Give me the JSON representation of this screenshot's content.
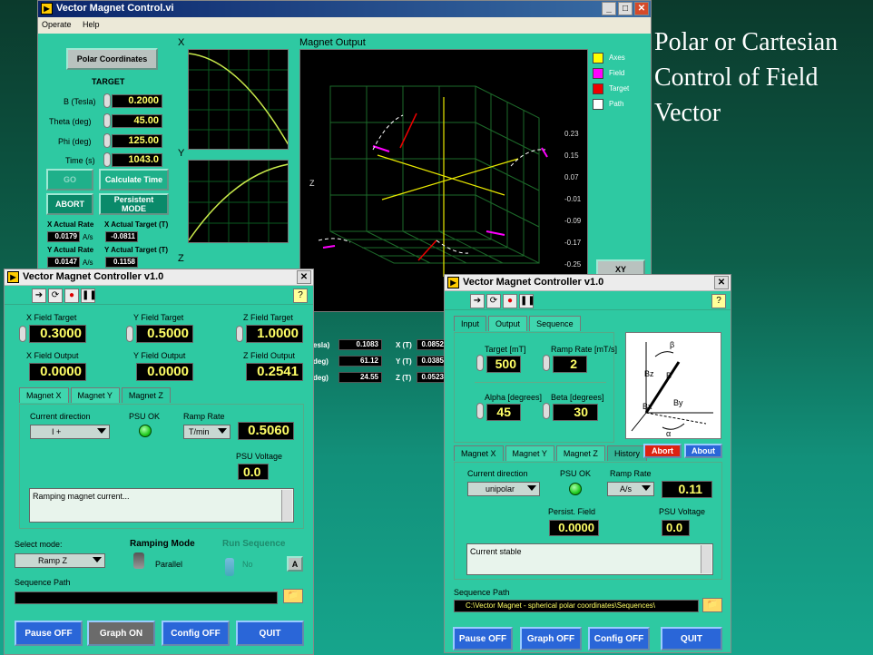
{
  "caption": [
    "Polar or Cartesian",
    "Control of Field",
    "Vector"
  ],
  "main": {
    "title": "Vector Magnet Control.vi",
    "menu": [
      "Operate",
      "Help"
    ],
    "polar_btn": "Polar Coordinates",
    "target_label": "TARGET",
    "fields": [
      {
        "label": "B (Tesla)",
        "value": "0.2000"
      },
      {
        "label": "Theta (deg)",
        "value": "45.00"
      },
      {
        "label": "Phi (deg)",
        "value": "125.00"
      },
      {
        "label": "Time (s)",
        "value": "1043.0"
      }
    ],
    "go": "GO",
    "calc": "Calculate Time",
    "abort": "ABORT",
    "persist": "Persistent  MODE",
    "xrate_label": "X Actual Rate",
    "xtarget_label": "X Actual Target (T)",
    "xrate": "0.0179",
    "xtarget": "-0.0811",
    "unit": "A/s",
    "yrate_label": "Y Actual Rate",
    "ytarget_label": "Y Actual Target (T)",
    "yrate": "0.0147",
    "ytarget": "0.1158",
    "plot_x": "X",
    "plot_y": "Y",
    "plot_z": "Z",
    "output_title": "Magnet Output",
    "legend": [
      {
        "name": "Axes",
        "color": "#ffff00"
      },
      {
        "name": "Field",
        "color": "#ff00ff"
      },
      {
        "name": "Target",
        "color": "#e00000"
      },
      {
        "name": "Path",
        "color": "#ffffff"
      }
    ],
    "xy_btn": "XY",
    "readouts": [
      {
        "label": "esla)",
        "val": "0.1083",
        "axis": "X (T)",
        "v2": "0.0852"
      },
      {
        "label": "deg)",
        "val": "61.12",
        "axis": "Y (T)",
        "v2": "0.0385"
      },
      {
        "label": "deg)",
        "val": "24.55",
        "axis": "Z (T)",
        "v2": "0.0523"
      }
    ],
    "z_axis": "Z",
    "z_ticks": [
      "0.23",
      "0.15",
      "0.07",
      "-0.01",
      "-0.09",
      "-0.17",
      "-0.25"
    ]
  },
  "left": {
    "title": "Vector Magnet Controller v1.0",
    "xft": "X Field Target",
    "yft": "Y Field Target",
    "zft": "Z Field Target",
    "xfv": "0.3000",
    "yfv": "0.5000",
    "zfv": "1.0000",
    "xfo": "X Field Output",
    "yfo": "Y Field Output",
    "zfo": "Z Field Output",
    "xov": "0.0000",
    "yov": "0.0000",
    "zov": "0.2541",
    "tabs": [
      "Magnet X",
      "Magnet Y",
      "Magnet Z"
    ],
    "cur_dir": "Current direction",
    "cur_val": "I +",
    "psu_ok": "PSU OK",
    "ramp_rate": "Ramp Rate",
    "ramp_unit": "T/min",
    "ramp_val": "0.5060",
    "psu_v": "PSU Voltage",
    "psu_val": "0.0",
    "msg": "Ramping magnet current...",
    "sel_mode": "Select mode:",
    "mode_val": "Ramp Z",
    "ramp_mode": "Ramping Mode",
    "parallel": "Parallel",
    "run_seq": "Run Sequence",
    "no": "No",
    "a": "A",
    "seq_path": "Sequence Path",
    "buttons": [
      "Pause OFF",
      "Graph ON",
      "Config OFF",
      "QUIT"
    ]
  },
  "right": {
    "title": "Vector Magnet Controller v1.0",
    "tabs": [
      "Input",
      "Output",
      "Sequence"
    ],
    "target": "Target [mT]",
    "target_val": "500",
    "ramp": "Ramp Rate [mT/s]",
    "ramp_val": "2",
    "alpha": "Alpha [degrees]",
    "alpha_val": "45",
    "beta": "Beta [degrees]",
    "beta_val": "30",
    "mtabs": [
      "Magnet X",
      "Magnet Y",
      "Magnet Z",
      "History"
    ],
    "abort": "Abort",
    "about": "About",
    "cur_dir": "Current direction",
    "cur_val": "unipolar",
    "psu_ok": "PSU OK",
    "ramp_rate": "Ramp Rate",
    "ramp_unit": "A/s",
    "ramp_num": "0.11",
    "persist": "Persist. Field",
    "persist_val": "0.0000",
    "psu_v": "PSU Voltage",
    "psu_val": "0.0",
    "msg": "Current stable",
    "seq_path": "Sequence Path",
    "path_val": "C:\\Vector Magnet - spherical polar coordinates\\Sequences\\",
    "diagram_labels": [
      "Bz",
      "B",
      "By",
      "Bx",
      "β",
      "α"
    ],
    "buttons": [
      "Pause OFF",
      "Graph OFF",
      "Config OFF",
      "QUIT"
    ]
  }
}
